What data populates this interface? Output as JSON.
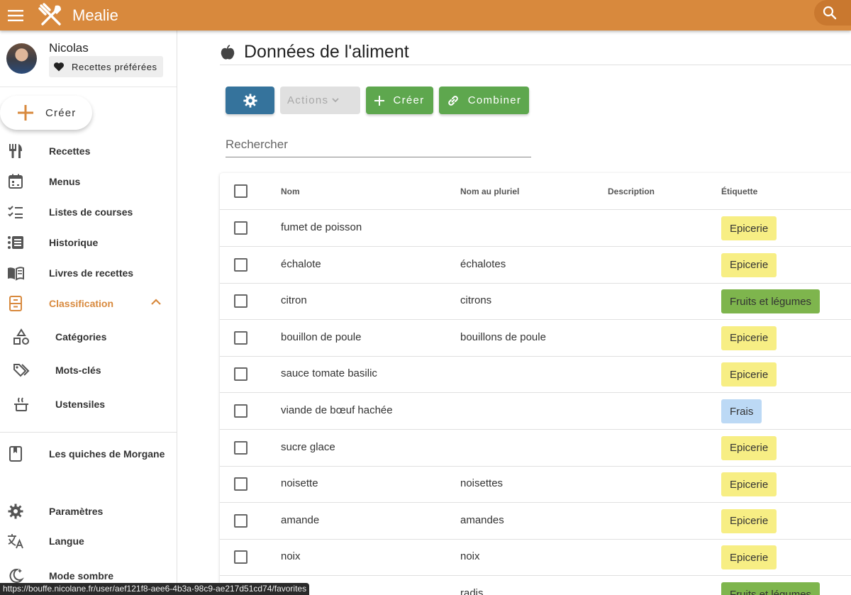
{
  "app": {
    "title": "Mealie"
  },
  "user": {
    "name": "Nicolas",
    "favorites_label": "Recettes préférées"
  },
  "sidebar": {
    "create_label": "Créer",
    "items": [
      {
        "label": "Recettes",
        "icon": "fork-knife-icon"
      },
      {
        "label": "Menus",
        "icon": "calendar-icon"
      },
      {
        "label": "Listes de courses",
        "icon": "checklist-icon"
      },
      {
        "label": "Historique",
        "icon": "timeline-icon"
      },
      {
        "label": "Livres de recettes",
        "icon": "book-open-icon"
      },
      {
        "label": "Classification",
        "icon": "file-cabinet-icon",
        "active": true
      }
    ],
    "sub_items": [
      {
        "label": "Catégories",
        "icon": "shapes-icon"
      },
      {
        "label": "Mots-clés",
        "icon": "tags-icon"
      },
      {
        "label": "Ustensiles",
        "icon": "pot-icon"
      }
    ],
    "cookbook": {
      "label": "Les quiches de Morgane",
      "icon": "bookmark-book-icon"
    },
    "bottom": [
      {
        "label": "Paramètres",
        "icon": "gear-icon"
      },
      {
        "label": "Langue",
        "icon": "translate-icon"
      },
      {
        "label": "Mode sombre",
        "icon": "moon-icon"
      }
    ]
  },
  "page": {
    "title": "Données de l'aliment",
    "icon": "apple-icon"
  },
  "toolbar": {
    "actions_label": "Actions",
    "create_label": "Créer",
    "combine_label": "Combiner"
  },
  "search": {
    "placeholder": "Rechercher"
  },
  "table": {
    "headers": {
      "name": "Nom",
      "plural": "Nom au pluriel",
      "description": "Description",
      "label": "Étiquette"
    },
    "rows": [
      {
        "name": "fumet de poisson",
        "plural": "",
        "description": "",
        "label": "Epicerie"
      },
      {
        "name": "échalote",
        "plural": "échalotes",
        "description": "",
        "label": "Epicerie"
      },
      {
        "name": "citron",
        "plural": "citrons",
        "description": "",
        "label": "Fruits et légumes"
      },
      {
        "name": "bouillon de poule",
        "plural": "bouillons de poule",
        "description": "",
        "label": "Epicerie"
      },
      {
        "name": "sauce tomate basilic",
        "plural": "",
        "description": "",
        "label": "Epicerie"
      },
      {
        "name": "viande de bœuf hachée",
        "plural": "",
        "description": "",
        "label": "Frais"
      },
      {
        "name": "sucre glace",
        "plural": "",
        "description": "",
        "label": "Epicerie"
      },
      {
        "name": "noisette",
        "plural": "noisettes",
        "description": "",
        "label": "Epicerie"
      },
      {
        "name": "amande",
        "plural": "amandes",
        "description": "",
        "label": "Epicerie"
      },
      {
        "name": "noix",
        "plural": "noix",
        "description": "",
        "label": "Epicerie"
      },
      {
        "name": "",
        "plural": "radis",
        "description": "",
        "label": "Fruits et légumes"
      }
    ]
  },
  "status_url": "https://bouffe.nicolane.fr/user/aef121f8-aee6-4b3a-98c9-ae217d51cd74/favorites",
  "colors": {
    "appbar": "#d8893d",
    "primary": "#35739c",
    "success": "#5ea74e",
    "chip_epicerie": "#f7ee84",
    "chip_fruits": "#7eb54d",
    "chip_frais": "#bcd9f5"
  }
}
